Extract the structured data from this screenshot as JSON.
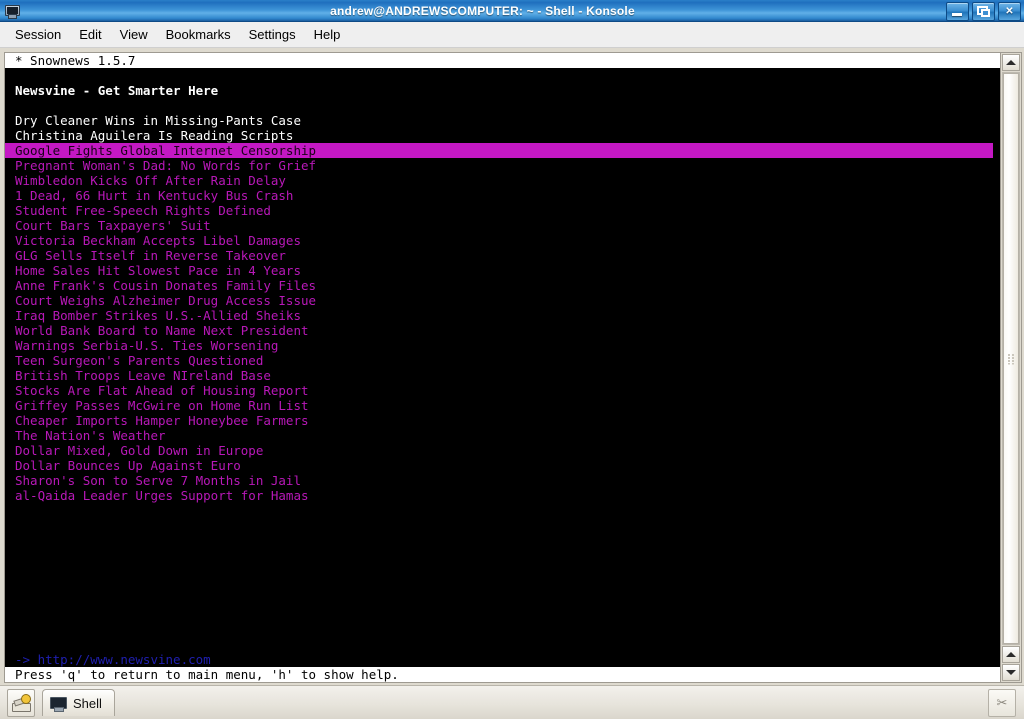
{
  "window": {
    "title": "andrew@ANDREWSCOMPUTER: ~ - Shell - Konsole",
    "app_icon": "terminal-icon",
    "buttons": {
      "minimize": "minimize-button",
      "maximize": "maximize-restore-button",
      "close_label": "✕"
    }
  },
  "menubar": {
    "items": [
      {
        "label": "Session"
      },
      {
        "label": "Edit"
      },
      {
        "label": "View"
      },
      {
        "label": "Bookmarks"
      },
      {
        "label": "Settings"
      },
      {
        "label": "Help"
      }
    ]
  },
  "terminal": {
    "app_header": "* Snownews 1.5.7",
    "feed_title": "Newsvine - Get Smarter Here",
    "feed_url": "-> http://www.newsvine.com",
    "status_line": "Press 'q' to return to main menu, 'h' to show help.",
    "selected_index": 2,
    "colors": {
      "background": "#000000",
      "read_item": "#b818b8",
      "unread_item": "#ffffff",
      "selection_background": "#c418c4",
      "url_text": "#1f1fb0",
      "header_background": "#ffffff",
      "header_text": "#000000"
    },
    "items": [
      {
        "text": "Dry Cleaner Wins in Missing-Pants Case",
        "state": "unread"
      },
      {
        "text": "Christina Aguilera Is Reading Scripts",
        "state": "unread"
      },
      {
        "text": "Google Fights Global Internet Censorship",
        "state": "selected"
      },
      {
        "text": "Pregnant Woman's Dad: No Words for Grief",
        "state": "read"
      },
      {
        "text": "Wimbledon Kicks Off After Rain Delay",
        "state": "read"
      },
      {
        "text": "1 Dead, 66 Hurt in Kentucky Bus Crash",
        "state": "read"
      },
      {
        "text": "Student Free-Speech Rights Defined",
        "state": "read"
      },
      {
        "text": "Court Bars Taxpayers' Suit",
        "state": "read"
      },
      {
        "text": "Victoria Beckham Accepts Libel Damages",
        "state": "read"
      },
      {
        "text": "GLG Sells Itself in Reverse Takeover",
        "state": "read"
      },
      {
        "text": "Home Sales Hit Slowest Pace in 4 Years",
        "state": "read"
      },
      {
        "text": "Anne Frank's Cousin Donates Family Files",
        "state": "read"
      },
      {
        "text": "Court Weighs Alzheimer Drug Access Issue",
        "state": "read"
      },
      {
        "text": "Iraq Bomber Strikes U.S.-Allied Sheiks",
        "state": "read"
      },
      {
        "text": "World Bank Board to Name Next President",
        "state": "read"
      },
      {
        "text": "Warnings Serbia-U.S. Ties Worsening",
        "state": "read"
      },
      {
        "text": "Teen Surgeon's Parents Questioned",
        "state": "read"
      },
      {
        "text": "British Troops Leave NIreland Base",
        "state": "read"
      },
      {
        "text": "Stocks Are Flat Ahead of Housing Report",
        "state": "read"
      },
      {
        "text": "Griffey Passes McGwire on Home Run List",
        "state": "read"
      },
      {
        "text": "Cheaper Imports Hamper Honeybee Farmers",
        "state": "read"
      },
      {
        "text": "The Nation's Weather",
        "state": "read"
      },
      {
        "text": "Dollar Mixed, Gold Down in Europe",
        "state": "read"
      },
      {
        "text": "Dollar Bounces Up Against Euro",
        "state": "read"
      },
      {
        "text": "Sharon's Son to Serve 7 Months in Jail",
        "state": "read"
      },
      {
        "text": "al-Qaida Leader Urges Support for Hamas",
        "state": "read"
      }
    ]
  },
  "scrollbar": {
    "up_button_top": "scroll-up",
    "up_button_bottom": "scroll-up",
    "down_button": "scroll-down"
  },
  "taskbar": {
    "launcher": "kde-menu-launcher",
    "tasks": [
      {
        "label": "Shell",
        "icon": "terminal-icon",
        "active": true
      }
    ],
    "tray_icon": "klipper-icon"
  }
}
